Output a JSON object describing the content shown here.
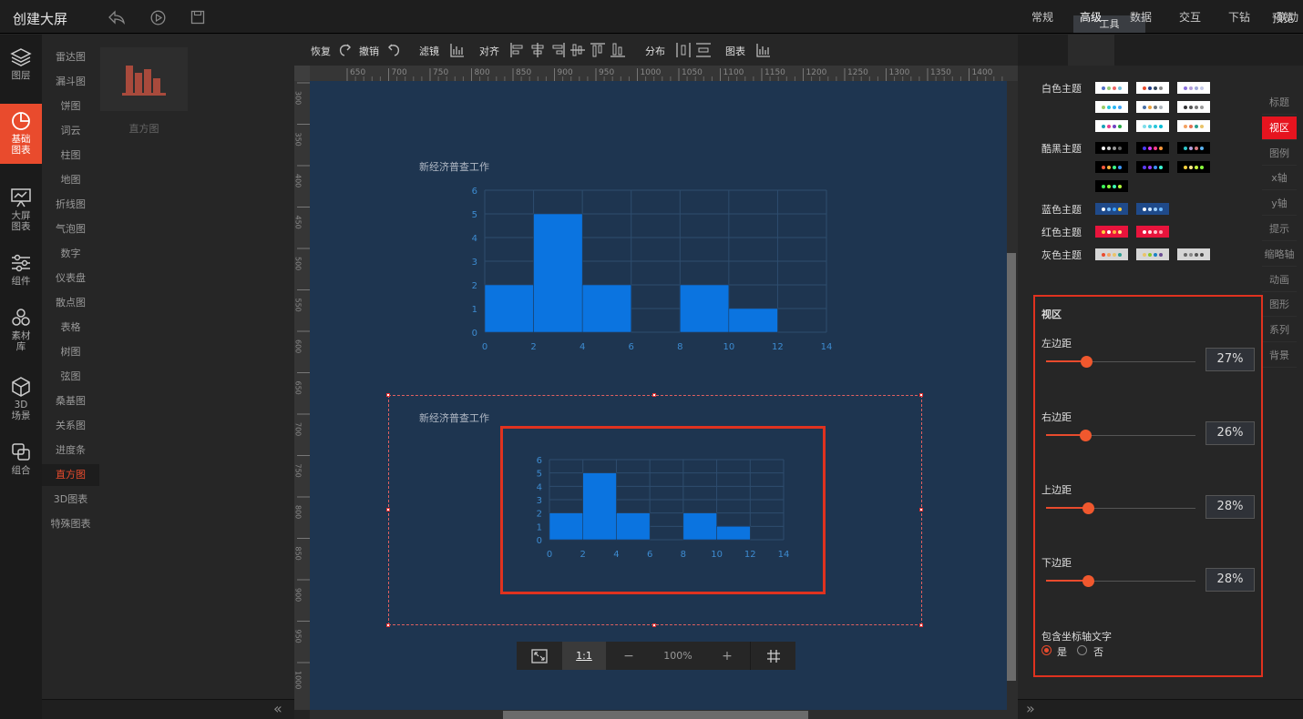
{
  "app": {
    "title": "创建大屏",
    "tools_tab": "工具",
    "preview": "预览"
  },
  "left_nav": [
    {
      "label_1": "图层",
      "label_2": "",
      "icon": "layers-icon"
    },
    {
      "label_1": "基础",
      "label_2": "图表",
      "icon": "pie-chart-icon"
    },
    {
      "label_1": "大屏",
      "label_2": "图表",
      "icon": "presentation-icon"
    },
    {
      "label_1": "组件",
      "label_2": "",
      "icon": "sliders-icon"
    },
    {
      "label_1": "素材",
      "label_2": "库",
      "icon": "hexagons-icon"
    },
    {
      "label_1": "3D",
      "label_2": "场景",
      "icon": "cube-icon"
    },
    {
      "label_1": "组合",
      "label_2": "",
      "icon": "group-icon"
    }
  ],
  "categories": [
    "雷达图",
    "漏斗图",
    "饼图",
    "词云",
    "柱图",
    "地图",
    "折线图",
    "气泡图",
    "数字",
    "仪表盘",
    "散点图",
    "表格",
    "树图",
    "弦图",
    "桑基图",
    "关系图",
    "进度条",
    "直方图",
    "3D图表",
    "特殊图表"
  ],
  "active_category": "直方图",
  "chart_thumb_label": "直方图",
  "toolbar": {
    "redo": "恢复",
    "undo": "撤销",
    "filter": "滤镜",
    "align": "对齐",
    "distribute": "分布",
    "chart": "图表"
  },
  "ruler_top": [
    "650",
    "700",
    "750",
    "800",
    "850",
    "900",
    "950",
    "1000",
    "1050",
    "1100",
    "1150",
    "1200",
    "1250",
    "1300",
    "1350",
    "1400"
  ],
  "ruler_left": [
    "300",
    "350",
    "400",
    "450",
    "500",
    "550",
    "600",
    "650",
    "700",
    "750",
    "800",
    "850",
    "900",
    "950",
    "1000"
  ],
  "charts": [
    {
      "title": "新经济普查工作"
    },
    {
      "title": "新经济普查工作"
    }
  ],
  "chart_data": [
    {
      "type": "bar",
      "title": "新经济普查工作",
      "x_ticks": [
        0,
        2,
        4,
        6,
        8,
        10,
        12,
        14
      ],
      "y_ticks": [
        0,
        1,
        2,
        3,
        4,
        5,
        6
      ],
      "ylim": [
        0,
        6
      ],
      "xlim": [
        0,
        14
      ],
      "bins": [
        {
          "x0": 0,
          "x1": 2,
          "value": 2
        },
        {
          "x0": 2,
          "x1": 4,
          "value": 5
        },
        {
          "x0": 4,
          "x1": 6,
          "value": 2
        },
        {
          "x0": 8,
          "x1": 10,
          "value": 2
        },
        {
          "x0": 10,
          "x1": 12,
          "value": 1
        }
      ],
      "color": "#0b74e0",
      "grid": true
    },
    {
      "type": "bar",
      "title": "新经济普查工作",
      "x_ticks": [
        0,
        2,
        4,
        6,
        8,
        10,
        12,
        14
      ],
      "y_ticks": [
        0,
        1,
        2,
        3,
        4,
        5,
        6
      ],
      "ylim": [
        0,
        6
      ],
      "xlim": [
        0,
        14
      ],
      "bins": [
        {
          "x0": 0,
          "x1": 2,
          "value": 2
        },
        {
          "x0": 2,
          "x1": 4,
          "value": 5
        },
        {
          "x0": 4,
          "x1": 6,
          "value": 2
        },
        {
          "x0": 8,
          "x1": 10,
          "value": 2
        },
        {
          "x0": 10,
          "x1": 12,
          "value": 1
        }
      ],
      "color": "#0b74e0",
      "grid": true
    }
  ],
  "zoom": {
    "ratio": "1:1",
    "minus": "−",
    "level": "100%",
    "plus": "+"
  },
  "tabs": [
    "常规",
    "高级",
    "数据",
    "交互",
    "下钻",
    "联动"
  ],
  "active_tab": "高级",
  "themes": [
    {
      "label": "白色主题",
      "swatches": [
        {
          "bg": "#ffffff",
          "dots": [
            "#5470c6",
            "#91cc75",
            "#ee6666",
            "#73c0de"
          ]
        },
        {
          "bg": "#ffffff",
          "dots": [
            "#e94b2d",
            "#1f3c88",
            "#33475b",
            "#888888"
          ]
        },
        {
          "bg": "#ffffff",
          "dots": [
            "#8a6fdf",
            "#b39ddb",
            "#9fa8da",
            "#c5cae9"
          ]
        },
        {
          "bg": "#ffffff",
          "dots": [
            "#9ccc65",
            "#26c6da",
            "#29b6f6",
            "#42a5f5"
          ]
        },
        {
          "bg": "#ffffff",
          "dots": [
            "#4a6fa5",
            "#e9a03b",
            "#6c757d",
            "#adb5bd"
          ]
        },
        {
          "bg": "#ffffff",
          "dots": [
            "#333333",
            "#555555",
            "#777777",
            "#999999"
          ]
        },
        {
          "bg": "#ffffff",
          "dots": [
            "#17a2b8",
            "#e83e8c",
            "#6f42c1",
            "#28a745"
          ]
        },
        {
          "bg": "#ffffff",
          "dots": [
            "#80deea",
            "#4dd0e1",
            "#26c6da",
            "#00bcd4"
          ]
        },
        {
          "bg": "#ffffff",
          "dots": [
            "#f4a261",
            "#e76f51",
            "#2a9d8f",
            "#e9c46a"
          ]
        }
      ]
    },
    {
      "label": "酷黑主题",
      "swatches": [
        {
          "bg": "#000000",
          "dots": [
            "#ffffff",
            "#cccccc",
            "#999999",
            "#666666"
          ]
        },
        {
          "bg": "#000000",
          "dots": [
            "#4b3cff",
            "#d63cff",
            "#ff3c8e",
            "#ff9a3c"
          ]
        },
        {
          "bg": "#000000",
          "dots": [
            "#2ec7c9",
            "#b6a2de",
            "#d87a80",
            "#5ab1ef"
          ]
        },
        {
          "bg": "#000000",
          "dots": [
            "#ff5a3c",
            "#ffb43c",
            "#3cff8a",
            "#3c9aff"
          ]
        },
        {
          "bg": "#000000",
          "dots": [
            "#5b3cff",
            "#9a3cff",
            "#3c8eff",
            "#3cffd6"
          ]
        },
        {
          "bg": "#000000",
          "dots": [
            "#ffd23c",
            "#ffe98a",
            "#c8ff3c",
            "#8aff3c"
          ]
        },
        {
          "bg": "#000000",
          "dots": [
            "#3cff5a",
            "#8aff3c",
            "#3cffb4",
            "#b4ff3c"
          ]
        }
      ]
    },
    {
      "label": "蓝色主题",
      "swatches": [
        {
          "bg": "#1f4a8a",
          "dots": [
            "#ffffff",
            "#7ec3ff",
            "#3ca0ff",
            "#ffd23c"
          ]
        },
        {
          "bg": "#1f4a8a",
          "dots": [
            "#ffffff",
            "#cde6ff",
            "#9ccfff",
            "#6ab8ff"
          ]
        }
      ]
    },
    {
      "label": "红色主题",
      "swatches": [
        {
          "bg": "#e8143c",
          "dots": [
            "#ffd23c",
            "#ffffff",
            "#ffb43c",
            "#ffe98a"
          ]
        },
        {
          "bg": "#e8143c",
          "dots": [
            "#ffffff",
            "#ffe0e6",
            "#ffc2cc",
            "#ffa3b3"
          ]
        }
      ]
    },
    {
      "label": "灰色主题",
      "swatches": [
        {
          "bg": "#d6d6d6",
          "dots": [
            "#e94b2d",
            "#f4a261",
            "#e9c46a",
            "#2a9d8f"
          ]
        },
        {
          "bg": "#d6d6d6",
          "dots": [
            "#e9c46a",
            "#8ac926",
            "#1982c4",
            "#6a4c93"
          ]
        },
        {
          "bg": "#d6d6d6",
          "dots": [
            "#666666",
            "#888888",
            "#555555",
            "#444444"
          ]
        }
      ]
    }
  ],
  "side_tabs": [
    "标题",
    "视区",
    "图例",
    "x轴",
    "y轴",
    "提示",
    "缩略轴",
    "动画",
    "图形",
    "系列",
    "背景"
  ],
  "active_side_tab": "视区",
  "viewport": {
    "title": "视区",
    "left": {
      "label": "左边距",
      "value": "27%",
      "fraction": 0.27
    },
    "right": {
      "label": "右边距",
      "value": "26%",
      "fraction": 0.26
    },
    "top": {
      "label": "上边距",
      "value": "28%",
      "fraction": 0.28
    },
    "bottom": {
      "label": "下边距",
      "value": "28%",
      "fraction": 0.28
    },
    "include_axis_text": {
      "label": "包含坐标轴文字",
      "yes": "是",
      "no": "否",
      "selected": "是"
    }
  }
}
